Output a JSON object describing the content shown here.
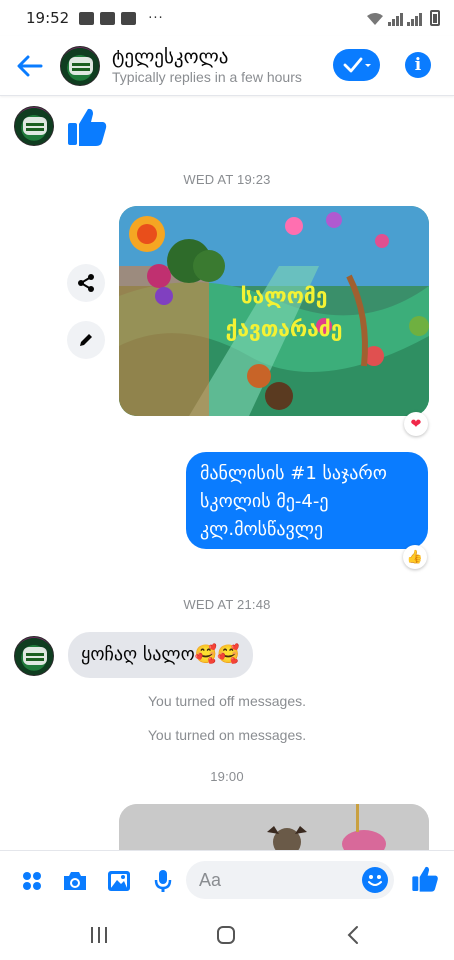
{
  "status_bar": {
    "time": "19:52",
    "dots": "···"
  },
  "header": {
    "title": "ტელესკოლა",
    "subtitle": "Typically replies in a few hours"
  },
  "messages": {
    "ts_1": "WED AT 19:23",
    "photo_caption_line1": "სალომე",
    "photo_caption_line2": "ქავთარაძე",
    "outgoing_text": "მანლისის #1 საჯარო სკოლის მე-4-ე კლ.მოსწავლე",
    "ts_2": "WED AT 21:48",
    "incoming_text": "ყოჩაღ სალო🥰🥰",
    "notice_off": "You turned off messages.",
    "notice_on": "You turned on messages.",
    "ts_3": "19:00",
    "photo_reaction": "❤",
    "text_reaction": "👍"
  },
  "composer": {
    "placeholder": "Aa"
  },
  "colors": {
    "accent": "#0a7cff",
    "bubble_in": "#e4e6eb",
    "meta_text": "#8a8d91"
  },
  "icons": [
    "arrow-left-icon",
    "check-icon",
    "chevron-down-icon",
    "info-icon",
    "thumbs-up-icon",
    "share-icon",
    "pencil-icon",
    "heart-icon",
    "grid-icon",
    "camera-icon",
    "image-icon",
    "microphone-icon",
    "emoji-icon",
    "recents-icon",
    "home-icon",
    "back-icon"
  ]
}
